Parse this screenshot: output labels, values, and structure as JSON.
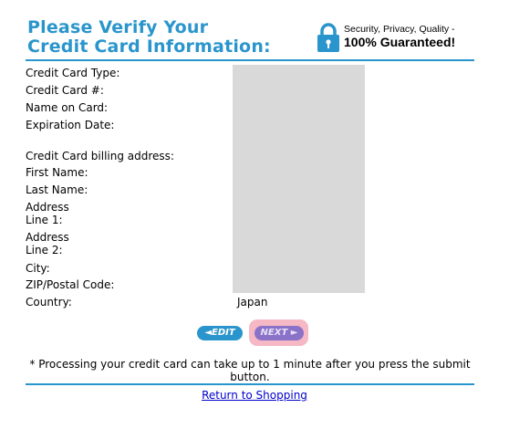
{
  "header": {
    "title_line1": "Please Verify Your",
    "title_line2": "Credit Card Information:",
    "badge_line1": "Security, Privacy, Quality -",
    "badge_line2": "100% Guaranteed!"
  },
  "card_fields": {
    "type_label": "Credit Card Type:",
    "number_label": "Credit Card #:",
    "name_label": "Name on Card:",
    "expiration_label": "Expiration Date:"
  },
  "billing": {
    "section_label": "Credit Card billing address:",
    "first_name_label": "First Name:",
    "last_name_label": "Last Name:",
    "address1_label_a": "Address",
    "address1_label_b": "Line 1:",
    "address2_label_a": "Address",
    "address2_label_b": "Line 2:",
    "city_label": "City:",
    "zip_label": "ZIP/Postal Code:",
    "country_label": "Country:",
    "country_value": "Japan"
  },
  "buttons": {
    "edit": "◄EDIT",
    "next": "NEXT ►"
  },
  "note": "* Processing your credit card can take up to 1 minute after you press the submit button.",
  "return_link": "Return to Shopping",
  "colors": {
    "accent": "#2a95cc",
    "redaction": "#d9d9d9",
    "next_button": "#8a72c9",
    "next_highlight": "#f5b8c4"
  }
}
